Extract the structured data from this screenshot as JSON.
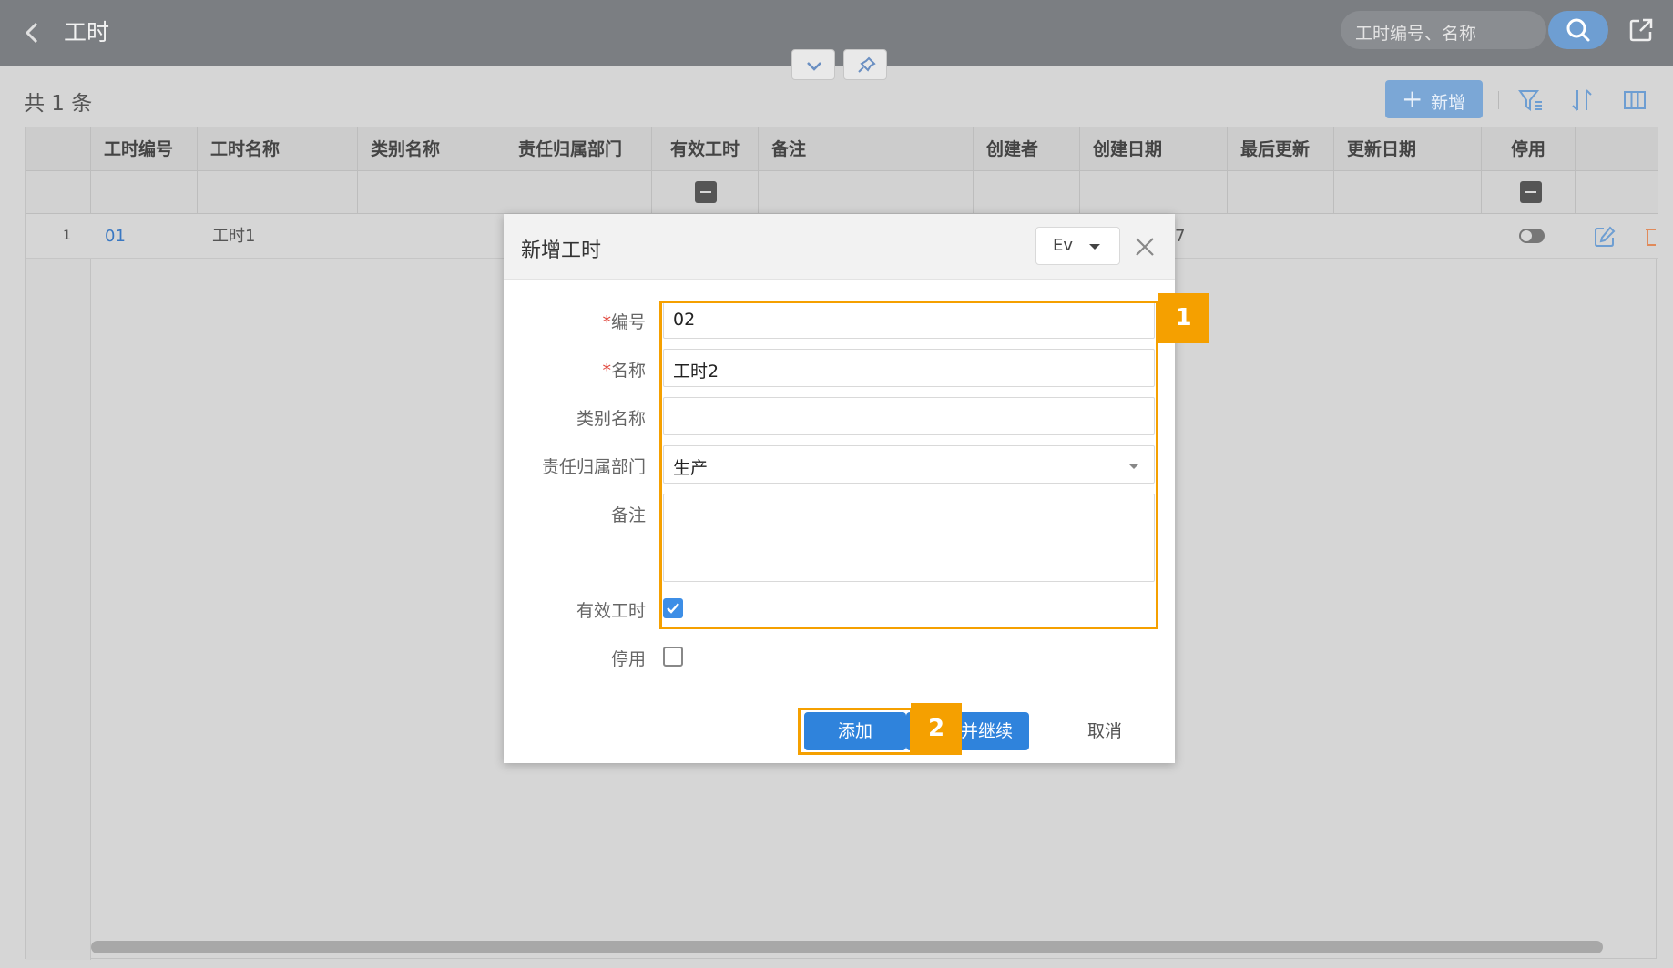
{
  "header": {
    "title": "工时",
    "search_placeholder": "工时编号、名称"
  },
  "toolbar": {
    "count_text": "共 1 条",
    "add_label": "新增"
  },
  "table": {
    "columns": [
      "工时编号",
      "工时名称",
      "类别名称",
      "责任归属部门",
      "有效工时",
      "备注",
      "创建者",
      "创建日期",
      "最后更新",
      "更新日期",
      "停用"
    ],
    "rows": [
      {
        "index": "1",
        "code": "01",
        "name": "工时1",
        "partial_date_tail": "7"
      }
    ]
  },
  "dialog": {
    "title": "新增工时",
    "language": "Ev",
    "fields": {
      "code": {
        "label": "编号",
        "required_mark": "*",
        "value": "02"
      },
      "name": {
        "label": "名称",
        "required_mark": "*",
        "value": "工时2"
      },
      "category": {
        "label": "类别名称",
        "value": ""
      },
      "department": {
        "label": "责任归属部门",
        "value": "生产"
      },
      "remark": {
        "label": "备注",
        "value": ""
      },
      "valid_hours": {
        "label": "有效工时",
        "checked": true
      },
      "disabled": {
        "label": "停用",
        "checked": false
      }
    },
    "buttons": {
      "add": "添加",
      "add_continue": "添加并继续",
      "cancel": "取消"
    }
  },
  "annotations": {
    "badge1": "1",
    "badge2": "2",
    "color": "#f5a000"
  },
  "colors": {
    "primary": "#2f83dc",
    "header_bg": "#7b7e82",
    "link": "#3a78c2",
    "required": "#e0443a"
  }
}
